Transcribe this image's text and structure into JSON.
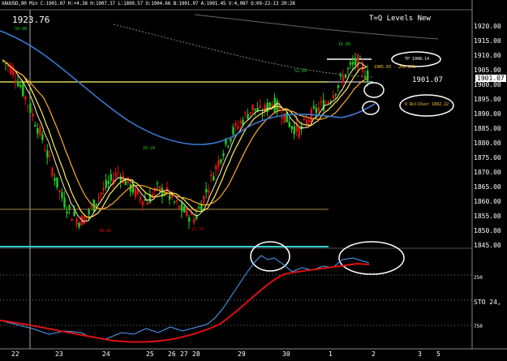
{
  "header": {
    "symbol_line": "XAUUSD,90 Min  C:1901.07  H:+4.38  H:1907.37  L:1899.57  O:1904.66  B:1901.07  A:1901.45  V:4,087  O:09-22-13  20:28"
  },
  "chart": {
    "current_big": "1923.76",
    "title": "T=Q Levels New",
    "last_price": "1901.07",
    "ind_label": "STO 24,",
    "labels": {
      "tp": "TP 1908.14",
      "level": "1905.03 - 200 EMA",
      "rollover": "O RollOver 1892.22",
      "price_tag": "1901.07",
      "n34": "34.98",
      "n5289": "52.89",
      "n1660": "16.60",
      "n2824": "28.24",
      "n4866": "- 48.66",
      "n2574": "- 25.74"
    },
    "y_ticks": [
      "1920.00",
      "1915.00",
      "1910.00",
      "1905.00",
      "1900.00",
      "1895.00",
      "1890.00",
      "1885.00",
      "1880.00",
      "1875.00",
      "1870.00",
      "1865.00",
      "1860.00",
      "1855.00",
      "1850.00",
      "1845.00"
    ],
    "ind_ticks": [
      "250",
      "750"
    ],
    "x_labels": [
      "22",
      "23",
      "24",
      "25",
      "26",
      "27",
      "28",
      "29",
      "30",
      "1",
      "2",
      "3",
      "5"
    ]
  },
  "colors": {
    "bg": "#000000",
    "up": "#22cc22",
    "down": "#dd1111",
    "ema_fast": "#ffee55",
    "ema_mid": "#ffaa33",
    "ema_blue": "#3a7bd5",
    "hline_yellow": "#ffff66",
    "cyan_line": "#33cccc",
    "stoch": "#4aa3ff",
    "stoch_signal": "#dd1111"
  }
}
